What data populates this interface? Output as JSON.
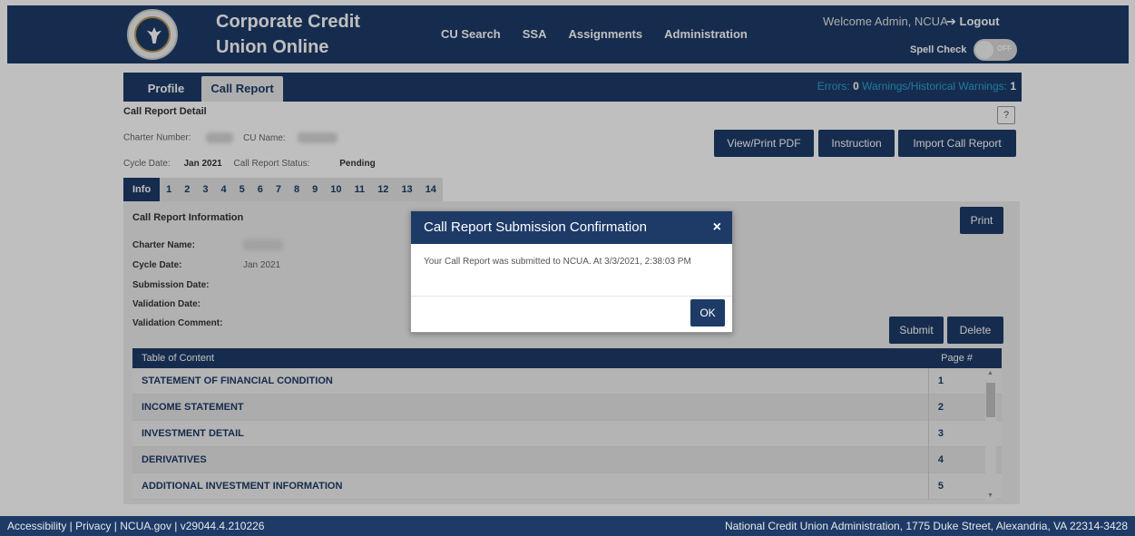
{
  "header": {
    "brand_line1": "Corporate Credit",
    "brand_line2": "Union Online",
    "nav": [
      "CU Search",
      "SSA",
      "Assignments",
      "Administration"
    ],
    "welcome": "Welcome Admin, NCUA",
    "logout": "➔ Logout",
    "spell_check_label": "Spell Check",
    "spell_check_state": "OFF"
  },
  "tabs": {
    "profile": "Profile",
    "call_report": "Call Report"
  },
  "status": {
    "errors_label": "Errors:",
    "errors_count": "0",
    "warnings_label": "Warnings/Historical Warnings:",
    "warnings_count": "1"
  },
  "detail": {
    "title": "Call Report Detail",
    "help": "?",
    "charter_number_label": "Charter Number:",
    "cu_name_label": "CU Name:",
    "cycle_date_label": "Cycle Date:",
    "cycle_date_value": "Jan 2021",
    "status_label": "Call Report Status:",
    "status_value": "Pending"
  },
  "actions": {
    "view_pdf": "View/Print PDF",
    "instruction": "Instruction",
    "import": "Import Call Report",
    "print": "Print",
    "submit": "Submit",
    "delete": "Delete"
  },
  "section_tabs": [
    "Info",
    "1",
    "2",
    "3",
    "4",
    "5",
    "6",
    "7",
    "8",
    "9",
    "10",
    "11",
    "12",
    "13",
    "14"
  ],
  "info": {
    "title": "Call Report Information",
    "charter_name_label": "Charter Name:",
    "cycle_date_label": "Cycle Date:",
    "cycle_date_value": "Jan 2021",
    "submission_date_label": "Submission Date:",
    "validation_date_label": "Validation Date:",
    "validation_comment_label": "Validation Comment:"
  },
  "toc": {
    "header": "Table of Content",
    "page_header": "Page #",
    "rows": [
      {
        "label": "STATEMENT OF FINANCIAL CONDITION",
        "page": "1"
      },
      {
        "label": "INCOME STATEMENT",
        "page": "2"
      },
      {
        "label": "INVESTMENT DETAIL",
        "page": "3"
      },
      {
        "label": "DERIVATIVES",
        "page": "4"
      },
      {
        "label": "ADDITIONAL INVESTMENT INFORMATION",
        "page": "5"
      }
    ]
  },
  "modal": {
    "title": "Call Report Submission Confirmation",
    "close": "×",
    "message": "Your Call Report was submitted to NCUA. At 3/3/2021, 2:38:03 PM",
    "ok": "OK"
  },
  "footer": {
    "left": "Accessibility | Privacy | NCUA.gov | v29044.4.210226",
    "right": "National Credit Union Administration, 1775 Duke Street, Alexandria, VA 22314-3428"
  },
  "colors": {
    "primary": "#1e3b68",
    "accent": "#2aa4d8"
  }
}
